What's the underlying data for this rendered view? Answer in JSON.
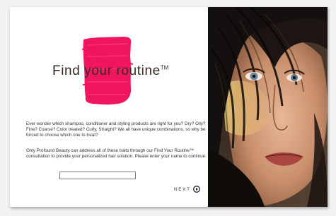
{
  "title": {
    "main": "Find your routine",
    "trademark": "TM"
  },
  "intro": {
    "paragraph1": "Ever wonder which shampoo, conditioner and styling products are right for you? Dry? Oily? Fine? Coarse? Color treated? Curly, Straight? We all have unique combinations, so why be forced to choose which one to treat?",
    "paragraph2": "Only Profound Beauty can address all of these traits through our Find Your Routine™ consultation to provide your personalized hair solution. Please enter your name to continue:"
  },
  "name_input": {
    "value": "",
    "placeholder": ""
  },
  "navigation": {
    "next_label": "NEXT",
    "next_icon": "play-circle-icon"
  },
  "colors": {
    "accent_pink": "#f0155f",
    "title_brown": "#3a2a22",
    "text": "#333333"
  },
  "hero_image": {
    "subject": "woman-face-dark-hair"
  }
}
